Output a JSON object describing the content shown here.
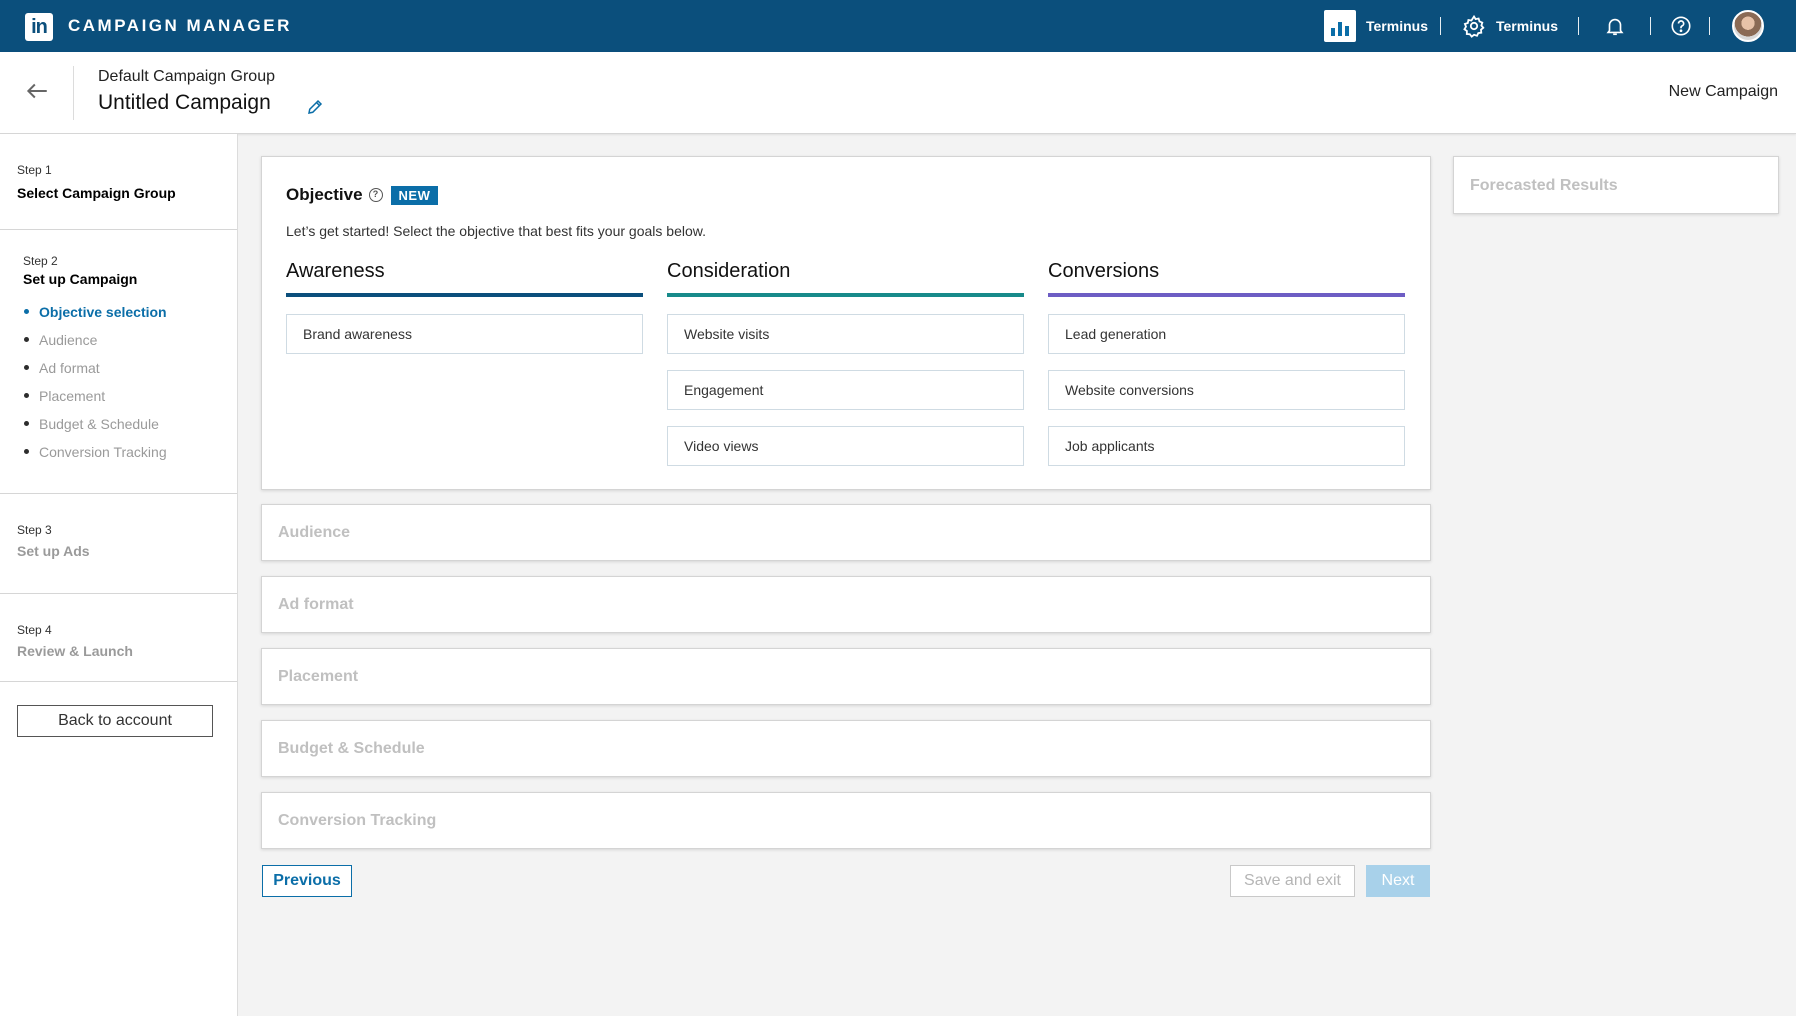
{
  "topbar": {
    "logo_text": "in",
    "app_title": "CAMPAIGN MANAGER",
    "account_name": "Terminus",
    "settings_account": "Terminus"
  },
  "header": {
    "group_name": "Default Campaign Group",
    "campaign_name": "Untitled Campaign",
    "page_label": "New Campaign"
  },
  "sidebar": {
    "step1": {
      "num": "Step 1",
      "title": "Select Campaign Group"
    },
    "step2": {
      "num": "Step 2",
      "title": "Set up Campaign",
      "substeps": [
        "Objective selection",
        "Audience",
        "Ad format",
        "Placement",
        "Budget & Schedule",
        "Conversion Tracking"
      ]
    },
    "step3": {
      "num": "Step 3",
      "title": "Set up Ads"
    },
    "step4": {
      "num": "Step 4",
      "title": "Review & Launch"
    },
    "back_label": "Back to account"
  },
  "objective": {
    "title": "Objective",
    "badge": "NEW",
    "description": "Let’s get started! Select the objective that best fits your goals below.",
    "columns": [
      {
        "heading": "Awareness",
        "color": "#0b4f7c",
        "options": [
          "Brand awareness"
        ]
      },
      {
        "heading": "Consideration",
        "color": "#178a8a",
        "options": [
          "Website visits",
          "Engagement",
          "Video views"
        ]
      },
      {
        "heading": "Conversions",
        "color": "#6d5dc4",
        "options": [
          "Lead generation",
          "Website conversions",
          "Job applicants"
        ]
      }
    ]
  },
  "sections": [
    "Audience",
    "Ad format",
    "Placement",
    "Budget & Schedule",
    "Conversion Tracking"
  ],
  "buttons": {
    "previous": "Previous",
    "save_exit": "Save and exit",
    "next": "Next"
  },
  "forecast": {
    "title": "Forecasted Results"
  },
  "colors": {
    "brand": "#0b4f7c",
    "accent": "#0b6ea8",
    "disabled_next": "#a8d1ea"
  }
}
